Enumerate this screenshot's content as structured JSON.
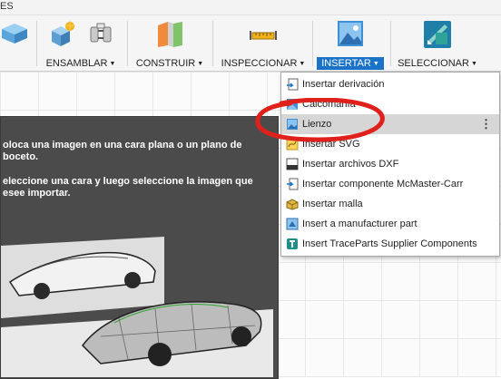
{
  "ribbon": {
    "tab_fragment": "ES",
    "groups": [
      {
        "label": "ENSAMBLAR",
        "icon": "assemble-icon"
      },
      {
        "label": "CONSTRUIR",
        "icon": "construct-icon"
      },
      {
        "label": "INSPECCIONAR",
        "icon": "inspect-icon"
      },
      {
        "label": "INSERTAR",
        "icon": "insert-image-icon",
        "active": true
      },
      {
        "label": "SELECCIONAR",
        "icon": "select-icon"
      }
    ]
  },
  "tooltip": {
    "line1": "oloca una imagen en una cara plana o un plano de boceto.",
    "line2": "eleccione una cara y luego seleccione la imagen que esee importar."
  },
  "insert_menu": {
    "items": [
      {
        "label": "Insertar derivación",
        "icon": "derive-icon"
      },
      {
        "label": "Calcomanía",
        "icon": "decal-icon"
      },
      {
        "label": "Lienzo",
        "icon": "canvas-icon",
        "highlighted": true
      },
      {
        "label": "Insertar SVG",
        "icon": "svg-icon"
      },
      {
        "label": "Insertar archivos DXF",
        "icon": "dxf-icon"
      },
      {
        "label": "Insertar componente McMaster-Carr",
        "icon": "mcmaster-icon"
      },
      {
        "label": "Insertar malla",
        "icon": "mesh-icon"
      },
      {
        "label": "Insert a manufacturer part",
        "icon": "manufacturer-part-icon"
      },
      {
        "label": "Insert TraceParts Supplier Components",
        "icon": "traceparts-icon"
      }
    ]
  },
  "colors": {
    "accent": "#1a73c9",
    "annotation": "#e0201a"
  }
}
